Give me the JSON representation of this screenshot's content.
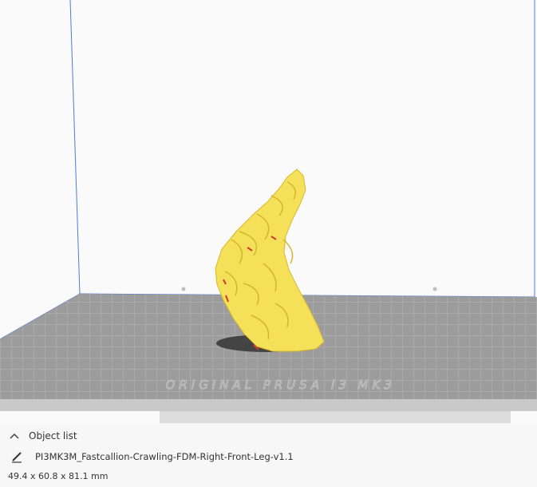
{
  "object_list": {
    "header_label": "Object list",
    "expand_icon": "chevron-up-icon",
    "items": [
      {
        "name": "PI3MK3M_Fastcallion-Crawling-FDM-Right-Front-Leg-v1.1",
        "icon": "pencil-icon"
      }
    ],
    "dimensions": "49.4 x 60.8 x 81.1 mm"
  },
  "viewport": {
    "bed_label": "ORIGINAL PRUSA i3 MK3",
    "colors": {
      "frame_lines": "#4d7bd8",
      "bed_fill": "#9c9c9c",
      "model_fill": "#f5e05a",
      "model_overhang": "#d23a2a",
      "shadow": "#444444"
    }
  }
}
